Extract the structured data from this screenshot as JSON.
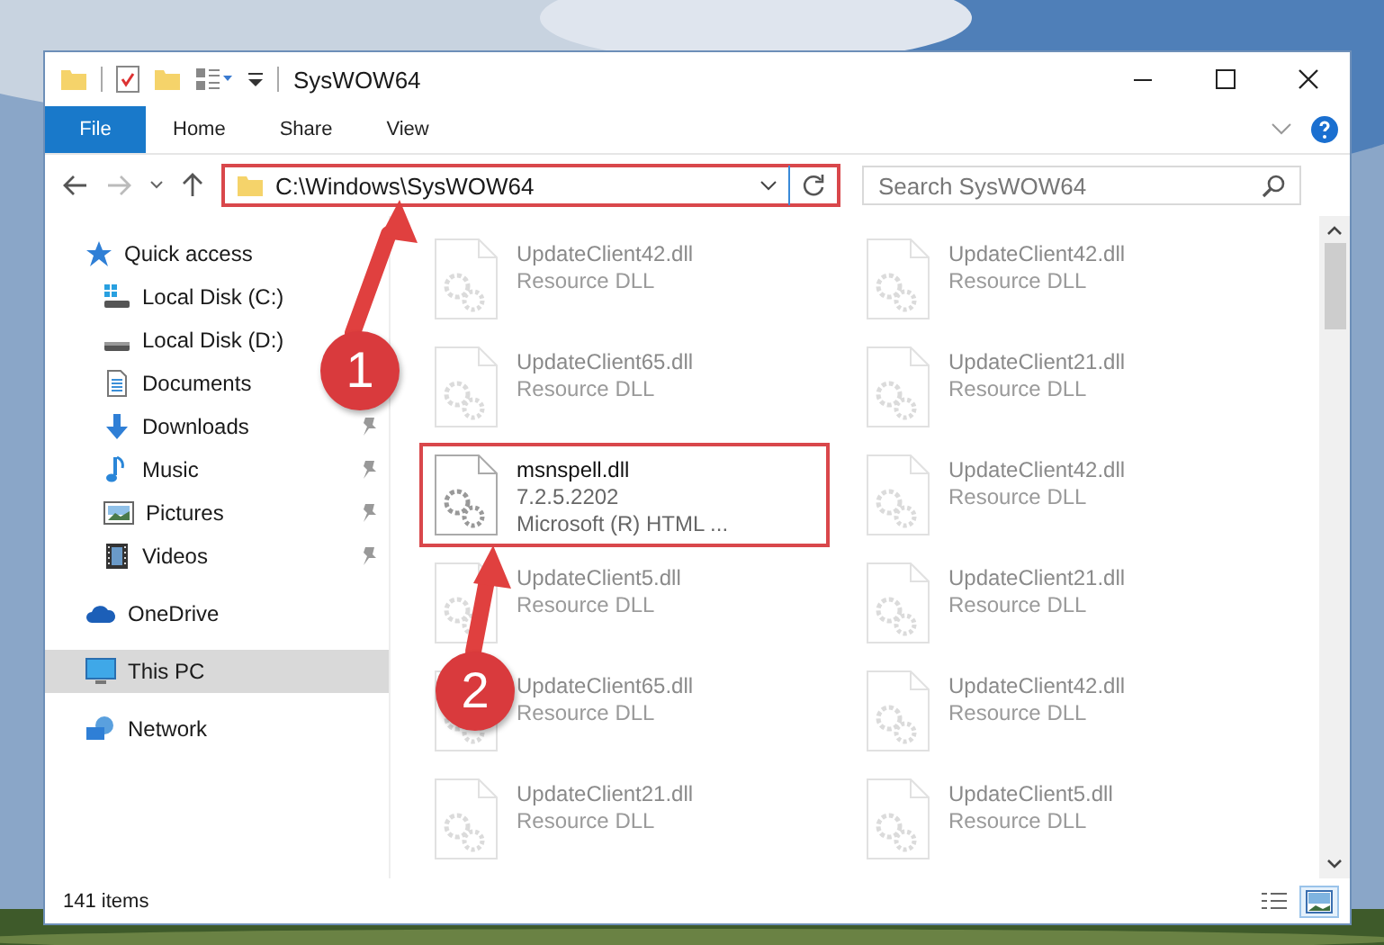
{
  "window": {
    "title": "SysWOW64"
  },
  "ribbon_tabs": [
    {
      "label": "File",
      "kind": "file",
      "selected": false
    },
    {
      "label": "Home",
      "kind": "tab",
      "selected": false
    },
    {
      "label": "Share",
      "kind": "tab",
      "selected": false
    },
    {
      "label": "View",
      "kind": "tab",
      "selected": false
    }
  ],
  "address_bar": {
    "path": "C:\\Windows\\SysWOW64",
    "highlighted": true
  },
  "search": {
    "placeholder": "Search SysWOW64"
  },
  "sidebar": {
    "items": [
      {
        "label": "Quick access",
        "kind": "star",
        "selected": false,
        "children": [
          {
            "label": "Local Disk (C:)",
            "kind": "system-drive",
            "pinned": false,
            "selected": false
          },
          {
            "label": "Local Disk (D:)",
            "kind": "drive",
            "selected": false
          },
          {
            "label": "Documents",
            "kind": "documents",
            "selected": false
          },
          {
            "label": "Downloads",
            "kind": "downloads",
            "pinned": true,
            "selected": false
          },
          {
            "label": "Music",
            "kind": "music",
            "pinned": true,
            "selected": false
          },
          {
            "label": "Pictures",
            "kind": "pictures",
            "pinned": true,
            "selected": false
          },
          {
            "label": "Videos",
            "kind": "videos",
            "pinned": true,
            "selected": false
          }
        ]
      },
      {
        "label": "OneDrive",
        "kind": "cloud",
        "selected": false
      },
      {
        "label": "This PC",
        "kind": "computer",
        "selected": true
      },
      {
        "label": "Network",
        "kind": "network",
        "selected": false
      }
    ]
  },
  "files": [
    {
      "name": "UpdateClient42.dll",
      "lines": [
        "Resource DLL"
      ],
      "blurred": true,
      "highlighted": false
    },
    {
      "name": "UpdateClient42.dll",
      "lines": [
        "Resource DLL"
      ],
      "blurred": true,
      "highlighted": false
    },
    {
      "name": "UpdateClient65.dll",
      "lines": [
        "Resource DLL"
      ],
      "blurred": true,
      "highlighted": false
    },
    {
      "name": "UpdateClient21.dll",
      "lines": [
        "Resource DLL"
      ],
      "blurred": true,
      "highlighted": false
    },
    {
      "name": "msnspell.dll",
      "lines": [
        "7.2.5.2202",
        "Microsoft (R) HTML ..."
      ],
      "blurred": false,
      "highlighted": true
    },
    {
      "name": "UpdateClient42.dll",
      "lines": [
        "Resource DLL"
      ],
      "blurred": true,
      "highlighted": false
    },
    {
      "name": "UpdateClient5.dll",
      "lines": [
        "Resource DLL"
      ],
      "blurred": true,
      "highlighted": false
    },
    {
      "name": "UpdateClient21.dll",
      "lines": [
        "Resource DLL"
      ],
      "blurred": true,
      "highlighted": false
    },
    {
      "name": "UpdateClient65.dll",
      "lines": [
        "Resource DLL"
      ],
      "blurred": true,
      "highlighted": false
    },
    {
      "name": "UpdateClient42.dll",
      "lines": [
        "Resource DLL"
      ],
      "blurred": true,
      "highlighted": false
    },
    {
      "name": "UpdateClient21.dll",
      "lines": [
        "Resource DLL"
      ],
      "blurred": true,
      "highlighted": false
    },
    {
      "name": "UpdateClient5.dll",
      "lines": [
        "Resource DLL"
      ],
      "blurred": true,
      "highlighted": false
    }
  ],
  "status_bar": {
    "item_count": "141 items",
    "views": [
      {
        "kind": "details",
        "selected": false
      },
      {
        "kind": "large-icons",
        "selected": true
      }
    ]
  },
  "annotations": [
    {
      "label": "1"
    },
    {
      "label": "2"
    }
  ]
}
